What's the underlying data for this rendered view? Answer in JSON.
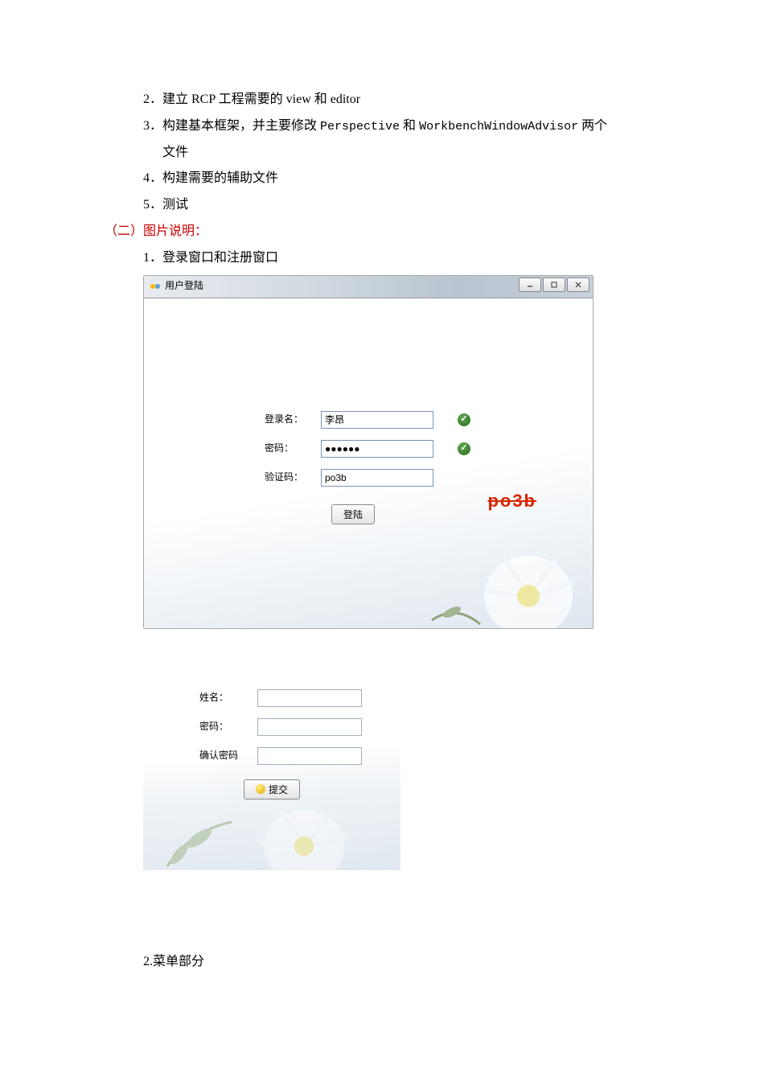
{
  "doc": {
    "item2": "2．建立 RCP 工程需要的 view 和 editor",
    "item3_a": "3．构建基本框架，并主要修改 ",
    "item3_p": "Perspective",
    "item3_b": " 和 ",
    "item3_w": "WorkbenchWindowAdvisor",
    "item3_c": " 两个",
    "item3_d": "文件",
    "item4": "4．构建需要的辅助文件",
    "item5": "5．测试",
    "section2": "（二）图片说明：",
    "sub1": "1．登录窗口和注册窗口",
    "menu": "2.菜单部分"
  },
  "login": {
    "windowTitle": "用户登陆",
    "usernameLabel": "登录名：",
    "usernameValue": "李昂",
    "passwordLabel": "密码：",
    "passwordValue": "●●●●●●",
    "captchaLabel": "验证码：",
    "captchaInputValue": "po3b",
    "captchaImageText": "po3b",
    "loginBtn": "登陆"
  },
  "register": {
    "nameLabel": "姓名：",
    "pwdLabel": "密码：",
    "confirmLabel": "确认密码",
    "submitBtn": "提交"
  }
}
